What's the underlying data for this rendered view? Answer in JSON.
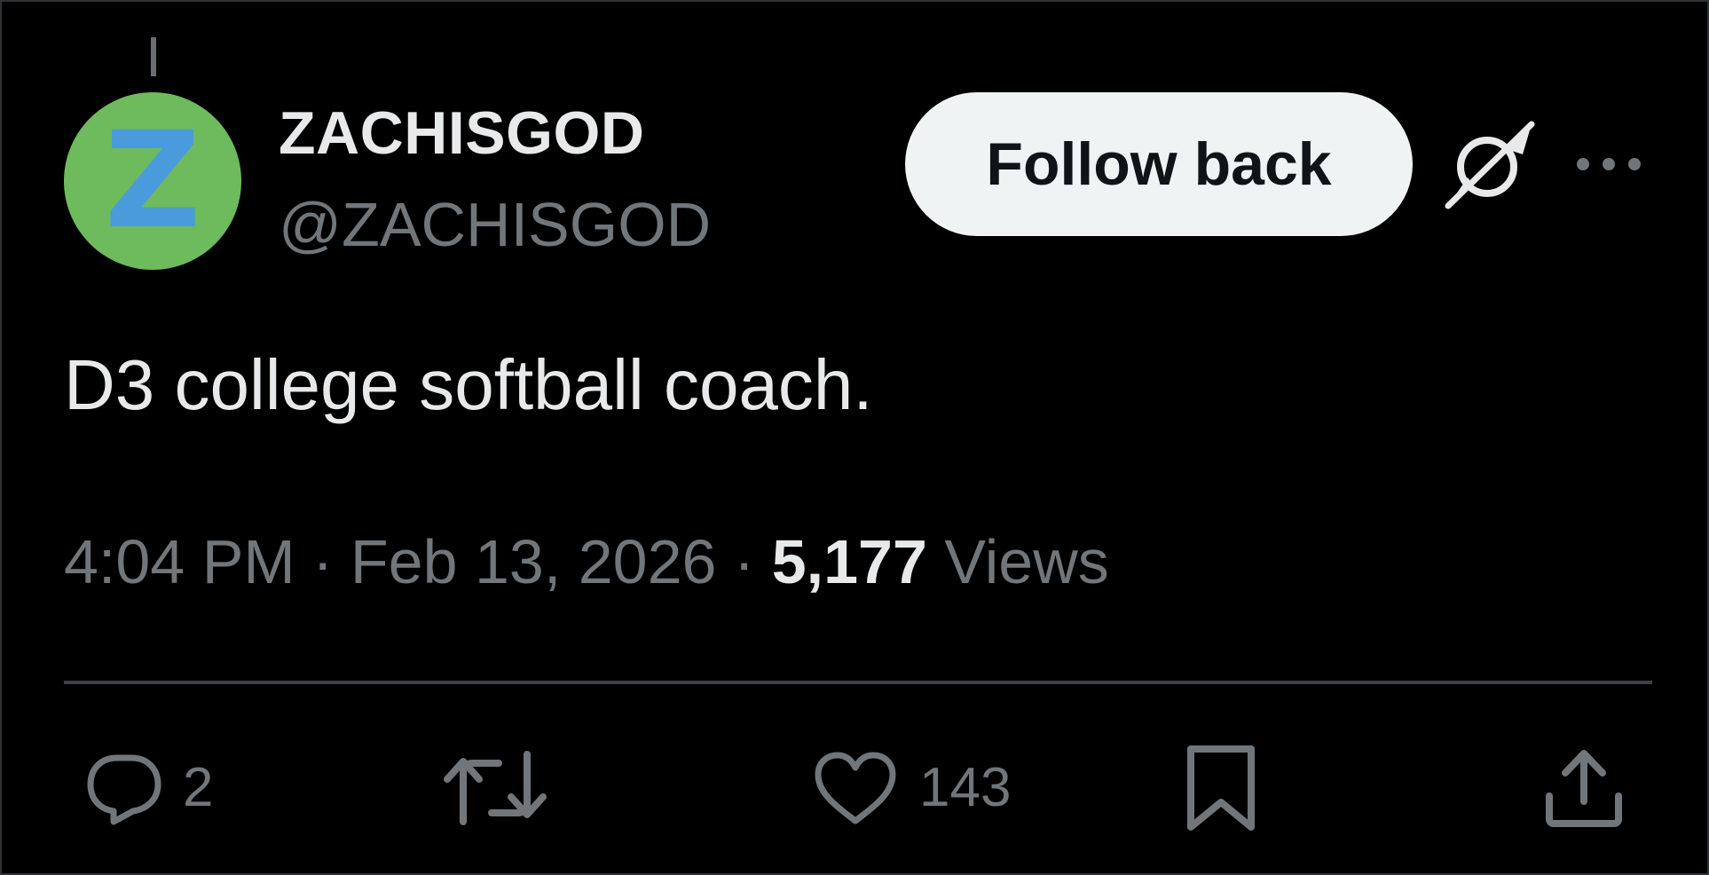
{
  "post": {
    "author": {
      "display_name": "ZACHISGOD",
      "handle": "@ZACHISGOD",
      "avatar_letter": "Z"
    },
    "follow_button_label": "Follow back",
    "text": "D3 college softball coach.",
    "time": "4:04 PM",
    "date": "Feb 13, 2026",
    "separator": "·",
    "views_count": "5,177",
    "views_label": "Views"
  },
  "actions": {
    "reply_count": "2",
    "retweet_count": "",
    "like_count": "143"
  },
  "icons": {
    "grok": "grok-icon",
    "more": "more-icon",
    "reply": "reply-icon",
    "retweet": "retweet-icon",
    "like": "heart-icon",
    "bookmark": "bookmark-icon",
    "share": "share-icon"
  },
  "colors": {
    "background": "#000000",
    "primary_text": "#e7e9ea",
    "secondary_text": "#71767b",
    "follow_button_bg": "#eff3f4",
    "avatar_bg": "#6dbb5c",
    "avatar_letter": "#4a9bdc",
    "divider": "#3d4145"
  }
}
